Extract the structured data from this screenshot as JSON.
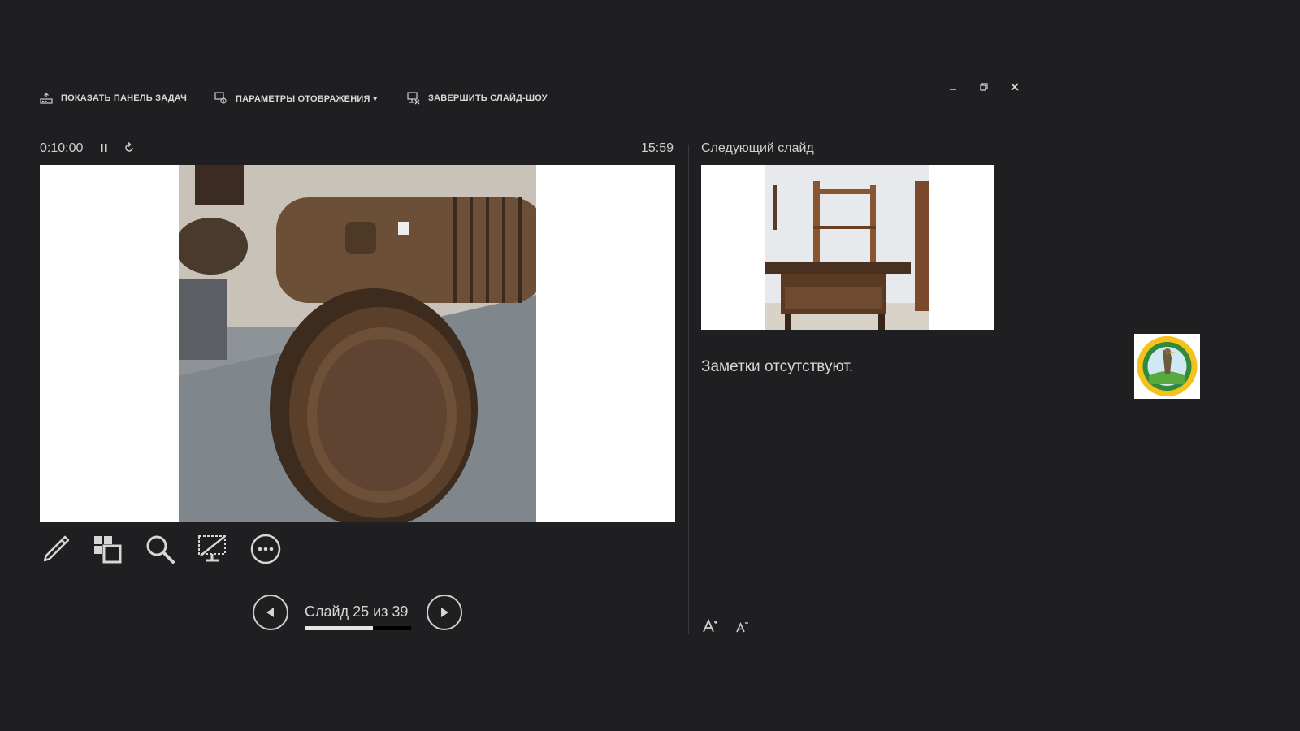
{
  "toolbar": {
    "show_taskbar": "ПОКАЗАТЬ ПАНЕЛЬ ЗАДАЧ",
    "display_settings": "ПАРАМЕТРЫ ОТОБРАЖЕНИЯ ▾",
    "end_show": "ЗАВЕРШИТЬ СЛАЙД-ШОУ"
  },
  "window_controls": [
    "minimize-icon",
    "restore-icon",
    "close-icon"
  ],
  "timer": {
    "elapsed": "0:10:00",
    "clock": "15:59"
  },
  "current_slide": {
    "image": "wooden-barrel-flask-photo"
  },
  "next_slide": {
    "label": "Следующий слайд",
    "image": "carpenter-workbench-photo"
  },
  "notes": {
    "text": "Заметки отсутствуют."
  },
  "tools": [
    "pen-icon",
    "all-slides-icon",
    "zoom-icon",
    "black-screen-icon",
    "more-options-icon"
  ],
  "navigation": {
    "counter": "Слайд 25 из 39",
    "current": 25,
    "total": 39,
    "progress": 0.64
  },
  "font_size": [
    "increase-font-icon",
    "decrease-font-icon"
  ],
  "logo": {
    "image": "reserve-logo-emblem"
  },
  "colors": {
    "background": "#1f1e21",
    "divider": "#3b3a3e",
    "text": "#d0d0d0"
  }
}
